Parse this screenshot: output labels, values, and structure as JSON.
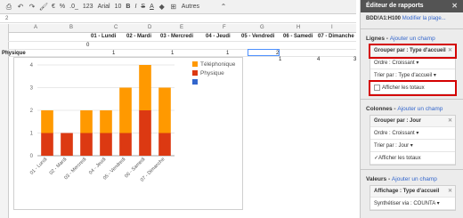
{
  "toolbar": {
    "font": "Arial",
    "font_size": "10",
    "more": "Autres",
    "currency": "€",
    "percent": "%",
    "decimals": ".0_",
    "format123": "123"
  },
  "formula_bar": {
    "row": "2"
  },
  "columns": [
    "A",
    "B",
    "C",
    "D",
    "E",
    "F",
    "G",
    "H",
    "I"
  ],
  "table": {
    "header": [
      "01 - Lundi",
      "02 - Mardi",
      "03 - Mercredi",
      "04 - Jeudi",
      "05 - Vendredi",
      "06 - Samedi",
      "07 - Dimanche"
    ],
    "row0": "0",
    "row1_label": "Physique",
    "row1": [
      "1",
      "1",
      "1",
      "2"
    ],
    "row2": [
      "1",
      "4",
      "3"
    ]
  },
  "chart_data": {
    "type": "bar",
    "stacked": true,
    "categories": [
      "01 - Lundi",
      "02 - Mardi",
      "03 - Mercredi",
      "04 - Jeudi",
      "05 - Vendredi",
      "06 - Samedi",
      "07 - Dimanche"
    ],
    "series": [
      {
        "name": "Physique",
        "color": "#dc3912",
        "values": [
          1,
          1,
          1,
          1,
          1,
          2,
          1
        ]
      },
      {
        "name": "Téléphonique",
        "color": "#ff9900",
        "values": [
          1,
          0,
          1,
          1,
          2,
          2,
          2
        ]
      },
      {
        "name": "",
        "color": "#3366cc",
        "values": [
          0,
          0,
          0,
          0,
          0,
          0,
          0
        ]
      }
    ],
    "ylim": [
      0,
      4
    ],
    "yticks": [
      "0",
      "1",
      "2",
      "3",
      "4"
    ],
    "legend": [
      "Téléphonique",
      "Physique",
      ""
    ],
    "legend_position": "right",
    "grid": true
  },
  "panel": {
    "title": "Éditeur de rapports",
    "range": "BDD!A1:H100",
    "range_link": "Modifier la plage...",
    "rows_label": "Lignes",
    "add_field": "Ajouter un champ",
    "group_by_type": "Grouper par : Type d'accueil",
    "order_asc": "Ordre : Croissant",
    "sort_by_type": "Trier par : Type d'accueil",
    "show_totals": "Afficher les totaux",
    "columns_label": "Colonnes",
    "group_by_day": "Grouper par : Jour",
    "sort_by_day": "Trier par : Jour",
    "values_label": "Valeurs",
    "display_type": "Affichage : Type d'accueil",
    "summarize": "Synthétiser via : COUNTA"
  }
}
